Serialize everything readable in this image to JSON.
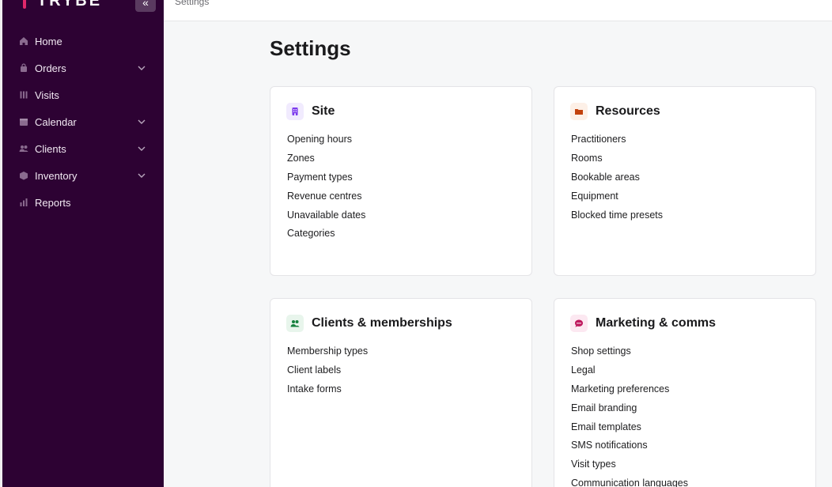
{
  "brand": {
    "name": "TRYBE"
  },
  "breadcrumb": "Settings",
  "page": {
    "title": "Settings"
  },
  "sidebar": {
    "items": [
      {
        "label": "Home",
        "icon": "home-icon",
        "has_children": false
      },
      {
        "label": "Orders",
        "icon": "bag-icon",
        "has_children": true
      },
      {
        "label": "Visits",
        "icon": "visits-icon",
        "has_children": false
      },
      {
        "label": "Calendar",
        "icon": "calendar-icon",
        "has_children": true
      },
      {
        "label": "Clients",
        "icon": "users-icon",
        "has_children": true
      },
      {
        "label": "Inventory",
        "icon": "box-icon",
        "has_children": true
      },
      {
        "label": "Reports",
        "icon": "chart-icon",
        "has_children": false
      }
    ]
  },
  "cards": {
    "site": {
      "title": "Site",
      "icon": "building-icon",
      "color": "#7c3aed",
      "links": [
        "Opening hours",
        "Zones",
        "Payment types",
        "Revenue centres",
        "Unavailable dates",
        "Categories"
      ]
    },
    "resources": {
      "title": "Resources",
      "icon": "folder-icon",
      "color": "#c2410c",
      "links": [
        "Practitioners",
        "Rooms",
        "Bookable areas",
        "Equipment",
        "Blocked time presets"
      ]
    },
    "clients": {
      "title": "Clients & memberships",
      "icon": "users-icon",
      "color": "#15803d",
      "links": [
        "Membership types",
        "Client labels",
        "Intake forms"
      ]
    },
    "marketing": {
      "title": "Marketing & comms",
      "icon": "chat-icon",
      "color": "#be185d",
      "links": [
        "Shop settings",
        "Legal",
        "Marketing preferences",
        "Email branding",
        "Email templates",
        "SMS notifications",
        "Visit types",
        "Communication languages"
      ]
    }
  },
  "colors": {
    "sidebar_bg": "#2d0233",
    "brand_accent": "#e0286a",
    "page_bg": "#f6f7f8"
  }
}
